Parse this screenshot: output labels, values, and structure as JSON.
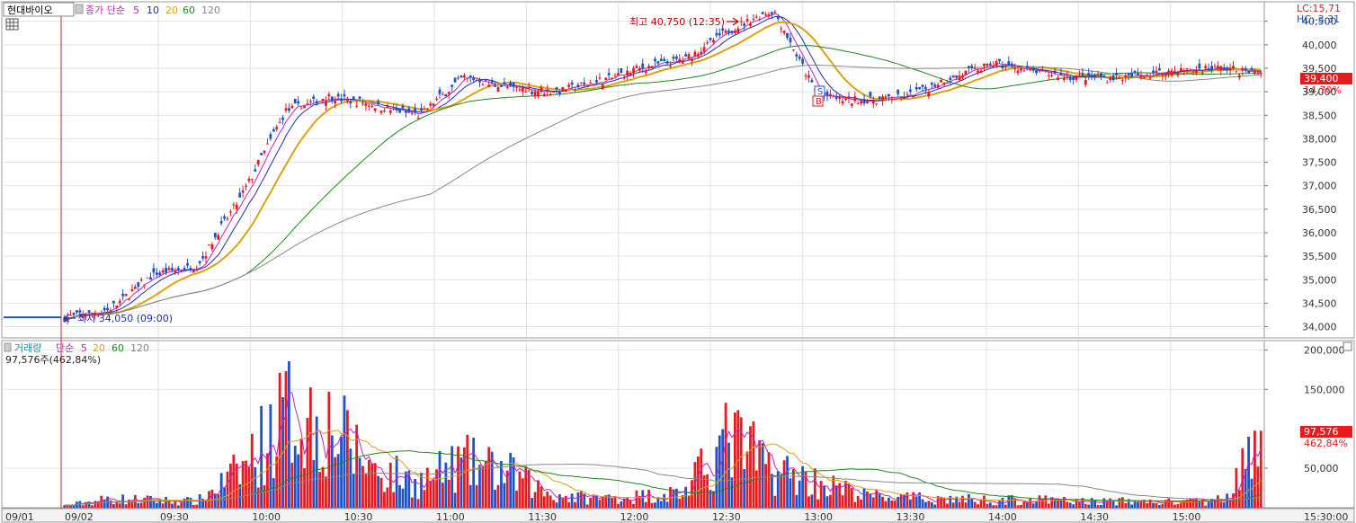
{
  "colors": {
    "up": "#e8191f",
    "down": "#1f52c8",
    "ma5": "#c81ec8",
    "ma10": "#1f2fa8",
    "ma20": "#e0a010",
    "ma60": "#1a8a1a",
    "ma120": "#888888",
    "grid": "#e2e2e2",
    "axis_bg": "#f2f2f2",
    "price_tag": "#e8191f"
  },
  "price_panel": {
    "title": "현대바이오",
    "legend_prefix": "종가 단순",
    "legend_periods": [
      "5",
      "10",
      "20",
      "60",
      "120"
    ],
    "lc_label": "LC:15,71",
    "hc_label": "HC:-3,31",
    "current_price_tag": "39,400",
    "current_change_tag": "14,70%",
    "high_annotation": "최고 40,750 (12:35)",
    "low_annotation": "최저 34,050 (09:00)",
    "marker_s": "S",
    "marker_b": "B",
    "y_ticks": [
      "40,500",
      "40,000",
      "39,500",
      "39,000",
      "38,500",
      "38,000",
      "37,500",
      "37,000",
      "36,500",
      "36,000",
      "35,500",
      "35,000",
      "34,500",
      "34,000"
    ]
  },
  "volume_panel": {
    "legend_prefix": "거래량",
    "legend_ma": "단순",
    "legend_periods": [
      "5",
      "20",
      "60",
      "120"
    ],
    "value_label": "97,576주(462,84%)",
    "volume_tag": "97,576",
    "volume_pct_tag": "462,84%",
    "y_ticks": [
      "200,000",
      "150,000",
      "50,000"
    ]
  },
  "x_axis": {
    "labels": [
      "09/01",
      "09/02",
      "09:30",
      "10:00",
      "10:30",
      "11:00",
      "11:30",
      "12:00",
      "12:30",
      "13:00",
      "13:30",
      "14:00",
      "14:30",
      "15:00",
      "15:30:00"
    ]
  },
  "chart_data": {
    "type": "candlestick+volume",
    "title": "현대바이오",
    "x": [
      "09/01",
      "09:00",
      "09:15",
      "09:30",
      "09:45",
      "10:00",
      "10:15",
      "10:30",
      "10:45",
      "11:00",
      "11:15",
      "11:30",
      "11:45",
      "12:00",
      "12:15",
      "12:30",
      "12:35",
      "12:45",
      "13:00",
      "13:15",
      "13:30",
      "13:45",
      "14:00",
      "14:15",
      "14:30",
      "14:45",
      "15:00",
      "15:20"
    ],
    "price_close": [
      34200,
      34350,
      35100,
      35300,
      36800,
      38600,
      38900,
      38700,
      38500,
      39300,
      39100,
      39000,
      39200,
      39500,
      39700,
      40300,
      40750,
      38900,
      38800,
      38900,
      39300,
      39600,
      39400,
      39300,
      39300,
      39450,
      39500,
      39400
    ],
    "volume": [
      3000,
      14000,
      12000,
      10000,
      60000,
      150000,
      130000,
      60000,
      40000,
      70000,
      55000,
      20000,
      15000,
      18000,
      25000,
      110000,
      60000,
      40000,
      20000,
      15000,
      14000,
      12000,
      12000,
      10000,
      10000,
      9000,
      10000,
      97576
    ],
    "price_ylim": [
      33800,
      40800
    ],
    "volume_ylim": [
      0,
      205000
    ],
    "moving_averages": [
      "5",
      "10",
      "20",
      "60",
      "120"
    ],
    "high": 40750,
    "low": 34050,
    "last_price": 39400,
    "last_volume": 97576
  }
}
